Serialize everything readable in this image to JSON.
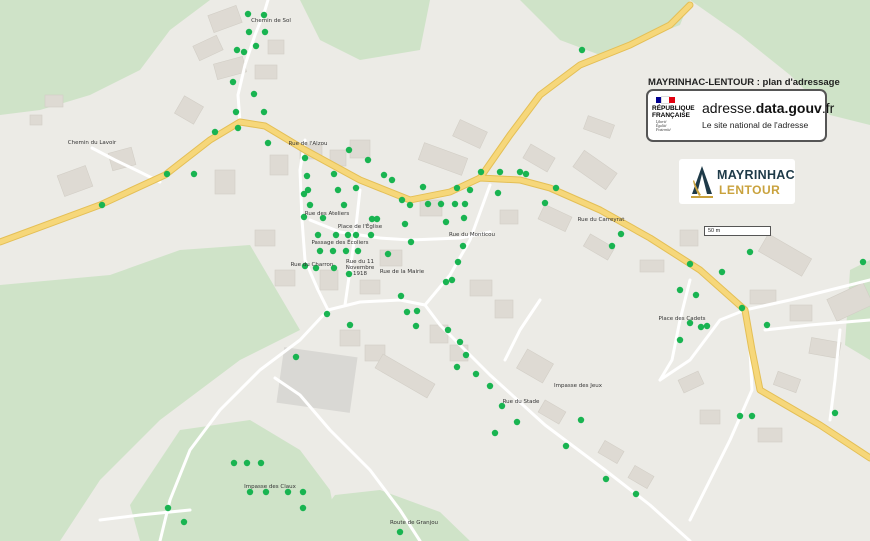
{
  "map_title": "MAYRINHAC-LENTOUR : plan d'adressage",
  "adresse_card": {
    "republic_name_line1": "RÉPUBLIQUE",
    "republic_name_line2": "FRANÇAISE",
    "motto": [
      "Liberté",
      "Égalité",
      "Fraternité"
    ],
    "flag_colors": [
      "#000091",
      "#ffffff",
      "#e1000f"
    ],
    "domain_prefix": "adresse.",
    "domain_bold": "data.gouv",
    "domain_suffix": ".fr",
    "tagline": "Le site national de l'adresse"
  },
  "commune_logo": {
    "line1": "MAYRINHAC",
    "line2": "LENTOUR",
    "colors": [
      "#1e3a48",
      "#c9a23d"
    ]
  },
  "scale": {
    "label": "50 m"
  },
  "street_labels": [
    "Chemin de Sol",
    "Chemin du Lavoir",
    "Rue de l'Alzou",
    "Rue des Ateliers",
    "Place de l'Église",
    "Passage des Écoliers",
    "Rue du Charron",
    "Rue du 11 Novembre 1918",
    "Rue de la Mairie",
    "Rue du Monticou",
    "Rue du Carreyrat",
    "Place des Cadets",
    "Impasse des Jeux",
    "Rue du Stade",
    "Impasse des Claux",
    "Route de Granjou"
  ],
  "colors": {
    "background": "#ecebe6",
    "woods": "#cfe3c8",
    "main_road": "#f6d77a",
    "main_road_casing": "#e4bf55",
    "minor_road": "#ffffff",
    "building": "#dedad3",
    "address_point": "#19b451"
  },
  "address_point_count": 121
}
